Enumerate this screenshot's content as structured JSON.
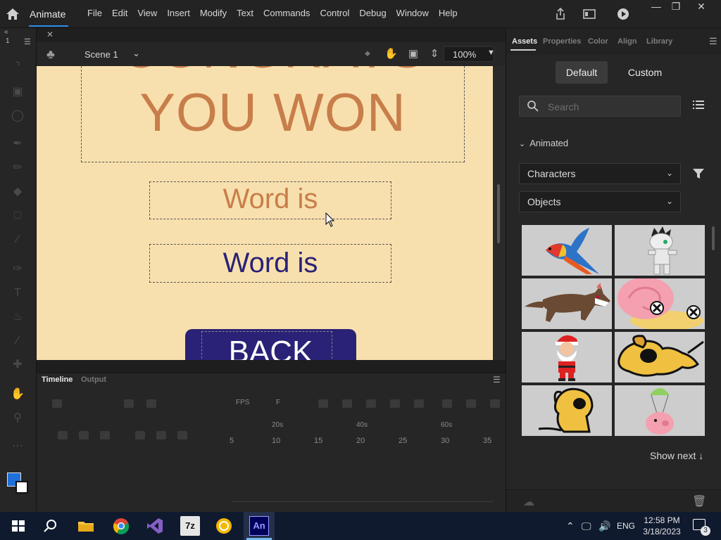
{
  "app": {
    "name": "Animate",
    "menu": [
      "File",
      "Edit",
      "View",
      "Insert",
      "Modify",
      "Text",
      "Commands",
      "Control",
      "Debug",
      "Window",
      "Help"
    ]
  },
  "tools": {
    "layer_number": "1"
  },
  "scene": {
    "name": "Scene 1",
    "zoom": "100%"
  },
  "stage": {
    "title_line1": "CONGRATS",
    "title_line2": "YOU WON",
    "word_label_1": "Word is",
    "word_label_2": "Word is",
    "back_button": "BACK",
    "colors": {
      "background": "#f8e0ae",
      "title": "#c87e4a",
      "word1": "#c87e4a",
      "word2": "#2a2276",
      "button": "#2a2276"
    }
  },
  "timeline": {
    "tabs": [
      "Timeline",
      "Output"
    ],
    "time_labels": [
      "20s",
      "40s",
      "60s"
    ],
    "frame_numbers": [
      "5",
      "10",
      "15",
      "20",
      "25",
      "30",
      "35"
    ],
    "fps_label": "FPS",
    "frame_label": "F"
  },
  "panel": {
    "tabs": [
      "Assets",
      "Properties",
      "Color",
      "Align",
      "Library"
    ],
    "active_tab": "Assets",
    "toggle": [
      "Default",
      "Custom"
    ],
    "search_placeholder": "Search",
    "section": "Animated",
    "dropdown1": "Characters",
    "dropdown2": "Objects",
    "assets": [
      "parrot",
      "mummy",
      "wolf",
      "snail",
      "santa",
      "dog-running",
      "dog-sitting",
      "pig-parachute"
    ],
    "show_next": "Show next ↓"
  },
  "taskbar": {
    "time": "12:58 PM",
    "date": "3/18/2023",
    "language": "ENG",
    "notification_count": "3",
    "apps": [
      "start",
      "search",
      "file-explorer",
      "chrome",
      "visual-studio",
      "7zip",
      "yellow-app",
      "animate"
    ],
    "animate_label": "An",
    "sevenzip_label": "7z"
  }
}
